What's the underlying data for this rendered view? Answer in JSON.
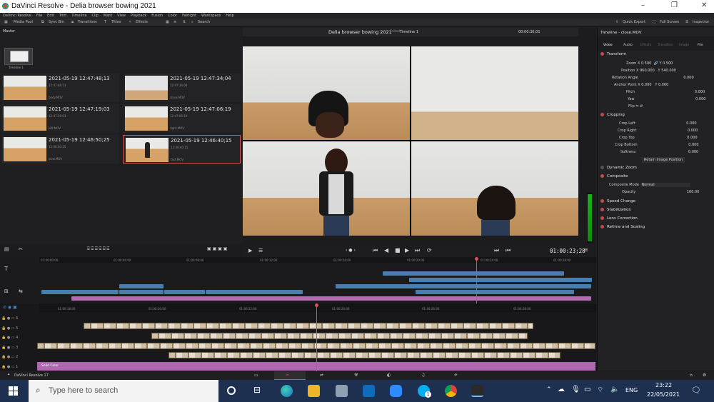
{
  "window": {
    "title": "DaVinci Resolve - Delia browser bowing 2021",
    "controls": [
      "–",
      "❐",
      "✕"
    ]
  },
  "menu": [
    "DaVinci Resolve",
    "File",
    "Edit",
    "Trim",
    "Timeline",
    "Clip",
    "Mark",
    "View",
    "Playback",
    "Fusion",
    "Color",
    "Fairlight",
    "Workspace",
    "Help"
  ],
  "toolbar": {
    "media_pool": "Media Pool",
    "sync_bin": "Sync Bin",
    "transitions": "Transitions",
    "titles": "Titles",
    "effects": "Effects",
    "search": "Search",
    "quick_export": "Quick Export",
    "full_screen": "Full Screen",
    "inspector": "Inspector"
  },
  "mediapool": {
    "bin": "Master",
    "timeline_item": "Timeline 1",
    "clips": [
      {
        "ts": "2021-05-19  12:47:48;13",
        "sub": "12:47:48:13",
        "file": "body.MOV"
      },
      {
        "ts": "2021-05-19  12:47:34;04",
        "sub": "12:47:34:04",
        "file": "close.MOV"
      },
      {
        "ts": "2021-05-19  12:47:19;03",
        "sub": "12:47:19:03",
        "file": "left.MOV"
      },
      {
        "ts": "2021-05-19  12:47:06;19",
        "sub": "12:47:06:19",
        "file": "right.MOV"
      },
      {
        "ts": "2021-05-19  12:46:50;25",
        "sub": "12:46:50:25",
        "file": "slow.MOV"
      },
      {
        "ts": "2021-05-19  12:46:40;15",
        "sub": "12:46:40:15",
        "file": "fast.MOV"
      }
    ]
  },
  "viewer": {
    "project_title": "Delia browser bowing 2021",
    "edited": "Edited",
    "timeline_name": "Timeline 1",
    "timecode": "00:00:30;01",
    "playback_timecode": "01:00:23;28"
  },
  "inspector": {
    "header": "Timeline - close.MOV",
    "tabs": [
      "Video",
      "Audio",
      "Effects",
      "Transition",
      "Image",
      "File"
    ],
    "transform": {
      "title": "Transform",
      "zoom_label": "Zoom",
      "zoom_x": "0.500",
      "zoom_y": "0.500",
      "position_label": "Position",
      "pos_x": "960.000",
      "pos_y": "540.000",
      "rotation_label": "Rotation Angle",
      "rotation": "0.000",
      "anchor_label": "Anchor Point",
      "anchor_x": "0.000",
      "anchor_y": "0.000",
      "pitch_label": "Pitch",
      "pitch": "0.000",
      "yaw_label": "Yaw",
      "yaw": "0.000",
      "flip_label": "Flip"
    },
    "cropping": {
      "title": "Cropping",
      "rows": [
        {
          "label": "Crop Left",
          "value": "0.000"
        },
        {
          "label": "Crop Right",
          "value": "0.000"
        },
        {
          "label": "Crop Top",
          "value": "0.000"
        },
        {
          "label": "Crop Bottom",
          "value": "0.000"
        },
        {
          "label": "Softness",
          "value": "0.000"
        }
      ],
      "retain": "Retain Image Position"
    },
    "dynamic_zoom": "Dynamic Zoom",
    "composite": {
      "title": "Composite",
      "mode_label": "Composite Mode",
      "mode": "Normal",
      "opacity_label": "Opacity",
      "opacity": "100.00"
    },
    "speed_change": "Speed Change",
    "stabilization": "Stabilization",
    "lens_correction": "Lens Correction",
    "retime": "Retime and Scaling"
  },
  "timeline": {
    "upper_ruler": [
      "01:00:00:00",
      "01:00:04:00",
      "01:00:08:00",
      "01:00:12:00",
      "01:00:16:00",
      "01:00:20:00",
      "01:00:24:00",
      "01:00:28:00"
    ],
    "lower_ruler": [
      "01:00:18:00",
      "01:00:20:00",
      "01:00:22:00",
      "01:00:24:00",
      "01:00:26:00",
      "01:00:28:00"
    ],
    "track_numbers": [
      "6",
      "5",
      "4",
      "3",
      "2",
      "1"
    ],
    "solid_color": "Solid Color"
  },
  "statusbar": {
    "app": "DaVinci Resolve 17"
  },
  "taskbar": {
    "search_placeholder": "Type here to search",
    "lang": "ENG",
    "time": "23:22",
    "date": "22/05/2021",
    "skype_badge": "1"
  }
}
